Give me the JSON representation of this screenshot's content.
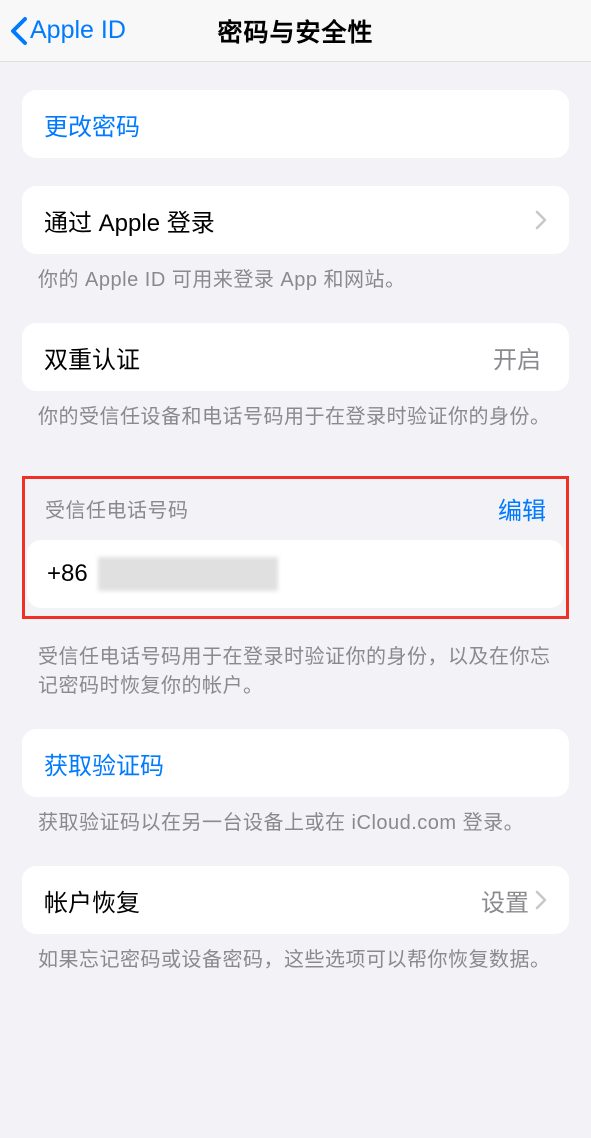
{
  "nav": {
    "back_label": "Apple ID",
    "title": "密码与安全性"
  },
  "change_password": {
    "label": "更改密码"
  },
  "sign_in_with_apple": {
    "label": "通过 Apple 登录",
    "footer": "你的 Apple ID 可用来登录 App 和网站。"
  },
  "two_factor": {
    "label": "双重认证",
    "status": "开启",
    "footer": "你的受信任设备和电话号码用于在登录时验证你的身份。"
  },
  "trusted_number": {
    "header_label": "受信任电话号码",
    "edit_label": "编辑",
    "prefix": "+86",
    "footer": "受信任电话号码用于在登录时验证你的身份，以及在你忘记密码时恢复你的帐户。"
  },
  "get_code": {
    "label": "获取验证码",
    "footer": "获取验证码以在另一台设备上或在 iCloud.com 登录。"
  },
  "account_recovery": {
    "label": "帐户恢复",
    "detail": "设置",
    "footer": "如果忘记密码或设备密码，这些选项可以帮你恢复数据。"
  }
}
